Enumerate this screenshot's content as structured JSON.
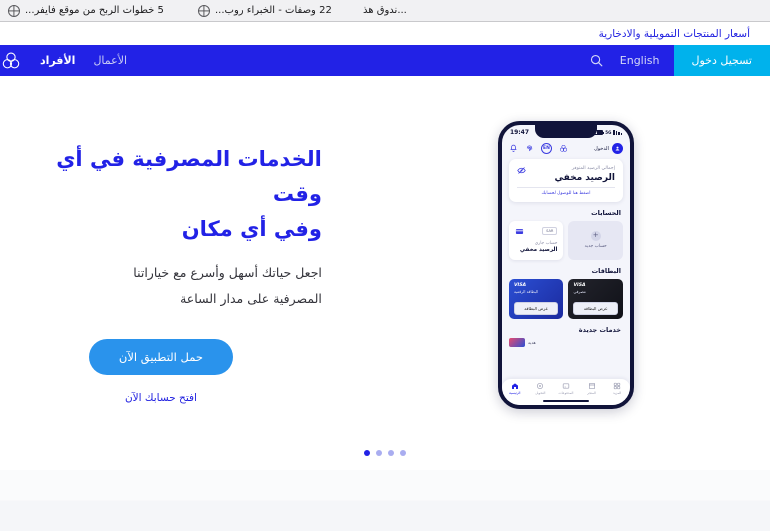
{
  "browser": {
    "tabs": [
      {
        "title": "...ندوق هذ",
        "icon": "globe-icon",
        "active": false
      },
      {
        "title": "22 وصفات - الخبراء روب...",
        "icon": "globe-icon",
        "active": false
      },
      {
        "title": "5 خطوات الربح من موقع فايفر...",
        "icon": "globe-icon",
        "active": false
      }
    ]
  },
  "utility_bar": {
    "link_label": "أسعار المنتجات التمويلية والادخارية",
    "link_color": "#2222e0"
  },
  "nav": {
    "logo_name": "bank-trefoil-logo",
    "brand_color": "#2222e6",
    "tabs": [
      {
        "label": "الأفراد",
        "active": true
      },
      {
        "label": "الأعمال",
        "active": false
      }
    ],
    "search_icon": "search-icon",
    "language_label": "English",
    "login_label": "تسجيل دخول",
    "login_color": "#00b2ec"
  },
  "hero": {
    "title_line1": "الخدمات المصرفية في أي وقت",
    "title_line2": "وفي أي مكان",
    "subtitle_line1": "اجعل حياتك أسهل وأسرع مع خياراتنا",
    "subtitle_line2": "المصرفية على مدار الساعة",
    "cta_button": "حمل التطبيق الآن",
    "cta_button_color": "#2a93ec",
    "cta_link": "افتح حسابك الآن",
    "carousel": {
      "total_dots": 4,
      "active_index": 3
    }
  },
  "phone": {
    "status": {
      "time": "19:47",
      "network": "5G"
    },
    "topbar": {
      "icons": [
        "bell-icon",
        "fingerprint-icon",
        "en-language-badge",
        "bank-logo-icon"
      ],
      "en_badge": "EN",
      "login_label": "الدخول",
      "avatar": "user-avatar-icon"
    },
    "balance": {
      "label": "إجمالي الرصيد المتوفر",
      "value": "الرصيد مخفي",
      "cta": "اضغط هنا للوصول لحسابك",
      "eye_icon": "eye-off-icon"
    },
    "accounts": {
      "title": "الحسابات",
      "new_account_label": "حساب جديد",
      "item": {
        "currency": "SAR",
        "type": "حساب جاري",
        "value": "الرصيد مخفي",
        "icon": "card-icon"
      }
    },
    "cards": {
      "title": "البطاقات",
      "items": [
        {
          "brand": "VISA",
          "name": "البطاقة الرقمية",
          "button": "عرض البطاقة",
          "style": "blue"
        },
        {
          "brand": "VISA",
          "name": "مصرفي",
          "button": "عرض البطاقة",
          "style": "dark"
        }
      ]
    },
    "services": {
      "title": "خدمات جديدة",
      "promo_label": "هدية"
    },
    "bottom_nav": [
      {
        "label": "الرئيسية",
        "icon": "home-icon",
        "active": true
      },
      {
        "label": "التحويل",
        "icon": "transfer-icon",
        "active": false
      },
      {
        "label": "المدفوعات",
        "icon": "payments-icon",
        "active": false
      },
      {
        "label": "المتجر",
        "icon": "store-icon",
        "active": false
      },
      {
        "label": "المزيد",
        "icon": "more-icon",
        "active": false
      }
    ]
  }
}
